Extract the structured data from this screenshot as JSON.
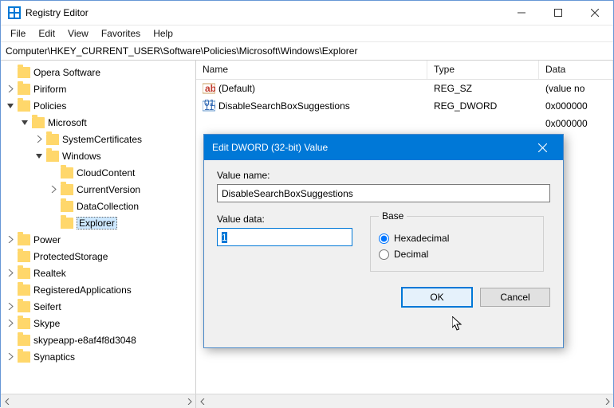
{
  "window": {
    "title": "Registry Editor",
    "menu": [
      "File",
      "Edit",
      "View",
      "Favorites",
      "Help"
    ],
    "address": "Computer\\HKEY_CURRENT_USER\\Software\\Policies\\Microsoft\\Windows\\Explorer"
  },
  "tree": [
    {
      "label": "Opera Software",
      "indent": 3,
      "exp": "none"
    },
    {
      "label": "Piriform",
      "indent": 3,
      "exp": "closed"
    },
    {
      "label": "Policies",
      "indent": 3,
      "exp": "open"
    },
    {
      "label": "Microsoft",
      "indent": 4,
      "exp": "open"
    },
    {
      "label": "SystemCertificates",
      "indent": 5,
      "exp": "closed"
    },
    {
      "label": "Windows",
      "indent": 5,
      "exp": "open"
    },
    {
      "label": "CloudContent",
      "indent": 6,
      "exp": "none"
    },
    {
      "label": "CurrentVersion",
      "indent": 6,
      "exp": "closed"
    },
    {
      "label": "DataCollection",
      "indent": 6,
      "exp": "none"
    },
    {
      "label": "Explorer",
      "indent": 6,
      "exp": "none",
      "selected": true
    },
    {
      "label": "Power",
      "indent": 3,
      "exp": "closed"
    },
    {
      "label": "ProtectedStorage",
      "indent": 3,
      "exp": "none"
    },
    {
      "label": "Realtek",
      "indent": 3,
      "exp": "closed"
    },
    {
      "label": "RegisteredApplications",
      "indent": 3,
      "exp": "none"
    },
    {
      "label": "Seifert",
      "indent": 3,
      "exp": "closed"
    },
    {
      "label": "Skype",
      "indent": 3,
      "exp": "closed"
    },
    {
      "label": "skypeapp-e8af4f8d3048",
      "indent": 3,
      "exp": "none"
    },
    {
      "label": "Synaptics",
      "indent": 3,
      "exp": "closed"
    }
  ],
  "columns": {
    "name": "Name",
    "type": "Type",
    "data": "Data"
  },
  "values": [
    {
      "name": "(Default)",
      "type": "REG_SZ",
      "data": "(value no",
      "icon": "ab"
    },
    {
      "name": "DisableSearchBoxSuggestions",
      "type": "REG_DWORD",
      "data": "0x000000",
      "icon": "bin"
    },
    {
      "name": "",
      "type": "",
      "data": "0x000000",
      "icon": ""
    }
  ],
  "dialog": {
    "title": "Edit DWORD (32-bit) Value",
    "label_value_name": "Value name:",
    "value_name": "DisableSearchBoxSuggestions",
    "label_value_data": "Value data:",
    "value_data": "1",
    "base_legend": "Base",
    "radio_hex": "Hexadecimal",
    "radio_dec": "Decimal",
    "ok": "OK",
    "cancel": "Cancel"
  }
}
